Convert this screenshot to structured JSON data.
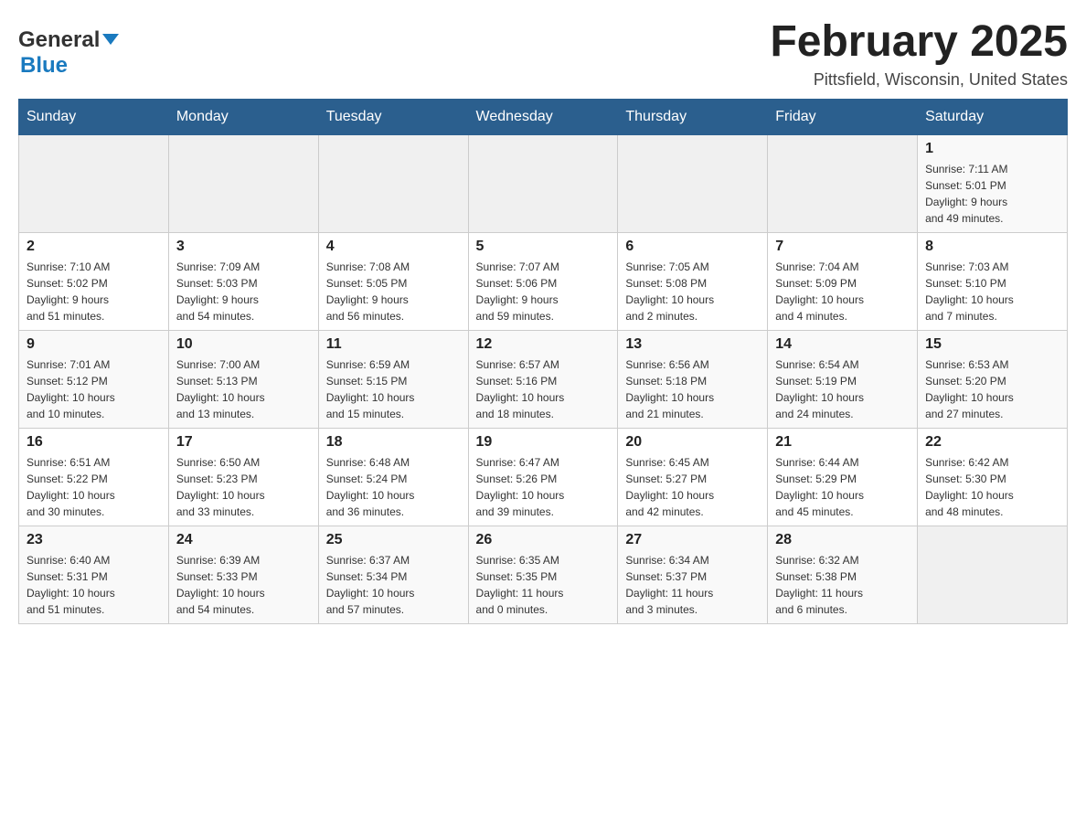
{
  "header": {
    "logo": {
      "general_text": "General",
      "blue_text": "Blue"
    },
    "title": "February 2025",
    "location": "Pittsfield, Wisconsin, United States"
  },
  "weekdays": [
    "Sunday",
    "Monday",
    "Tuesday",
    "Wednesday",
    "Thursday",
    "Friday",
    "Saturday"
  ],
  "weeks": [
    [
      {
        "day": "",
        "info": ""
      },
      {
        "day": "",
        "info": ""
      },
      {
        "day": "",
        "info": ""
      },
      {
        "day": "",
        "info": ""
      },
      {
        "day": "",
        "info": ""
      },
      {
        "day": "",
        "info": ""
      },
      {
        "day": "1",
        "info": "Sunrise: 7:11 AM\nSunset: 5:01 PM\nDaylight: 9 hours\nand 49 minutes."
      }
    ],
    [
      {
        "day": "2",
        "info": "Sunrise: 7:10 AM\nSunset: 5:02 PM\nDaylight: 9 hours\nand 51 minutes."
      },
      {
        "day": "3",
        "info": "Sunrise: 7:09 AM\nSunset: 5:03 PM\nDaylight: 9 hours\nand 54 minutes."
      },
      {
        "day": "4",
        "info": "Sunrise: 7:08 AM\nSunset: 5:05 PM\nDaylight: 9 hours\nand 56 minutes."
      },
      {
        "day": "5",
        "info": "Sunrise: 7:07 AM\nSunset: 5:06 PM\nDaylight: 9 hours\nand 59 minutes."
      },
      {
        "day": "6",
        "info": "Sunrise: 7:05 AM\nSunset: 5:08 PM\nDaylight: 10 hours\nand 2 minutes."
      },
      {
        "day": "7",
        "info": "Sunrise: 7:04 AM\nSunset: 5:09 PM\nDaylight: 10 hours\nand 4 minutes."
      },
      {
        "day": "8",
        "info": "Sunrise: 7:03 AM\nSunset: 5:10 PM\nDaylight: 10 hours\nand 7 minutes."
      }
    ],
    [
      {
        "day": "9",
        "info": "Sunrise: 7:01 AM\nSunset: 5:12 PM\nDaylight: 10 hours\nand 10 minutes."
      },
      {
        "day": "10",
        "info": "Sunrise: 7:00 AM\nSunset: 5:13 PM\nDaylight: 10 hours\nand 13 minutes."
      },
      {
        "day": "11",
        "info": "Sunrise: 6:59 AM\nSunset: 5:15 PM\nDaylight: 10 hours\nand 15 minutes."
      },
      {
        "day": "12",
        "info": "Sunrise: 6:57 AM\nSunset: 5:16 PM\nDaylight: 10 hours\nand 18 minutes."
      },
      {
        "day": "13",
        "info": "Sunrise: 6:56 AM\nSunset: 5:18 PM\nDaylight: 10 hours\nand 21 minutes."
      },
      {
        "day": "14",
        "info": "Sunrise: 6:54 AM\nSunset: 5:19 PM\nDaylight: 10 hours\nand 24 minutes."
      },
      {
        "day": "15",
        "info": "Sunrise: 6:53 AM\nSunset: 5:20 PM\nDaylight: 10 hours\nand 27 minutes."
      }
    ],
    [
      {
        "day": "16",
        "info": "Sunrise: 6:51 AM\nSunset: 5:22 PM\nDaylight: 10 hours\nand 30 minutes."
      },
      {
        "day": "17",
        "info": "Sunrise: 6:50 AM\nSunset: 5:23 PM\nDaylight: 10 hours\nand 33 minutes."
      },
      {
        "day": "18",
        "info": "Sunrise: 6:48 AM\nSunset: 5:24 PM\nDaylight: 10 hours\nand 36 minutes."
      },
      {
        "day": "19",
        "info": "Sunrise: 6:47 AM\nSunset: 5:26 PM\nDaylight: 10 hours\nand 39 minutes."
      },
      {
        "day": "20",
        "info": "Sunrise: 6:45 AM\nSunset: 5:27 PM\nDaylight: 10 hours\nand 42 minutes."
      },
      {
        "day": "21",
        "info": "Sunrise: 6:44 AM\nSunset: 5:29 PM\nDaylight: 10 hours\nand 45 minutes."
      },
      {
        "day": "22",
        "info": "Sunrise: 6:42 AM\nSunset: 5:30 PM\nDaylight: 10 hours\nand 48 minutes."
      }
    ],
    [
      {
        "day": "23",
        "info": "Sunrise: 6:40 AM\nSunset: 5:31 PM\nDaylight: 10 hours\nand 51 minutes."
      },
      {
        "day": "24",
        "info": "Sunrise: 6:39 AM\nSunset: 5:33 PM\nDaylight: 10 hours\nand 54 minutes."
      },
      {
        "day": "25",
        "info": "Sunrise: 6:37 AM\nSunset: 5:34 PM\nDaylight: 10 hours\nand 57 minutes."
      },
      {
        "day": "26",
        "info": "Sunrise: 6:35 AM\nSunset: 5:35 PM\nDaylight: 11 hours\nand 0 minutes."
      },
      {
        "day": "27",
        "info": "Sunrise: 6:34 AM\nSunset: 5:37 PM\nDaylight: 11 hours\nand 3 minutes."
      },
      {
        "day": "28",
        "info": "Sunrise: 6:32 AM\nSunset: 5:38 PM\nDaylight: 11 hours\nand 6 minutes."
      },
      {
        "day": "",
        "info": ""
      }
    ]
  ]
}
